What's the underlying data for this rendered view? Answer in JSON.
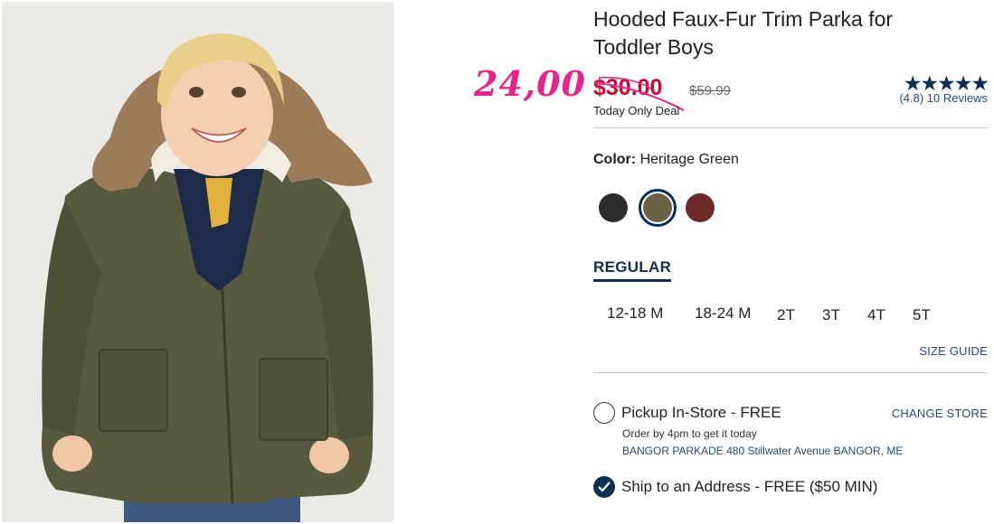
{
  "product": {
    "title": "Hooded Faux-Fur Trim Parka for Toddler Boys",
    "image_icon": "product-photo-toddler-parka"
  },
  "price": {
    "handwritten_price": "24,00",
    "sale_price": "$30.00",
    "original_price": "$59.99",
    "deal_label": "Today Only Deal"
  },
  "rating": {
    "stars": "★★★★★",
    "score_text": "(4.8)",
    "reviews_text": "10 Reviews",
    "value": 4.8
  },
  "color": {
    "label": "Color:",
    "selected_value": "Heritage Green",
    "swatches": [
      {
        "name": "black",
        "hex": "#2b2b2b"
      },
      {
        "name": "heritage-green",
        "hex": "#6b6246"
      },
      {
        "name": "burgundy",
        "hex": "#6e2a2a"
      }
    ],
    "selected_index": 1
  },
  "size": {
    "tab_label": "REGULAR",
    "options": [
      "12-18 M",
      "18-24 M",
      "2T",
      "3T",
      "4T",
      "5T"
    ],
    "guide_label": "SIZE GUIDE"
  },
  "fulfillment": {
    "pickup_label": "Pickup In-Store - FREE",
    "change_store_label": "CHANGE STORE",
    "pickup_note": "Order by 4pm to get it today",
    "store_address": "BANGOR PARKADE 480 Stillwater Avenue  BANGOR, ME",
    "ship_label": "Ship to an Address - FREE ($50 MIN)"
  },
  "colors": {
    "sale_red": "#cc0a2c",
    "navy": "#0c2f55",
    "link_blue": "#1f4a85",
    "annotation_pink": "#e8248c"
  }
}
